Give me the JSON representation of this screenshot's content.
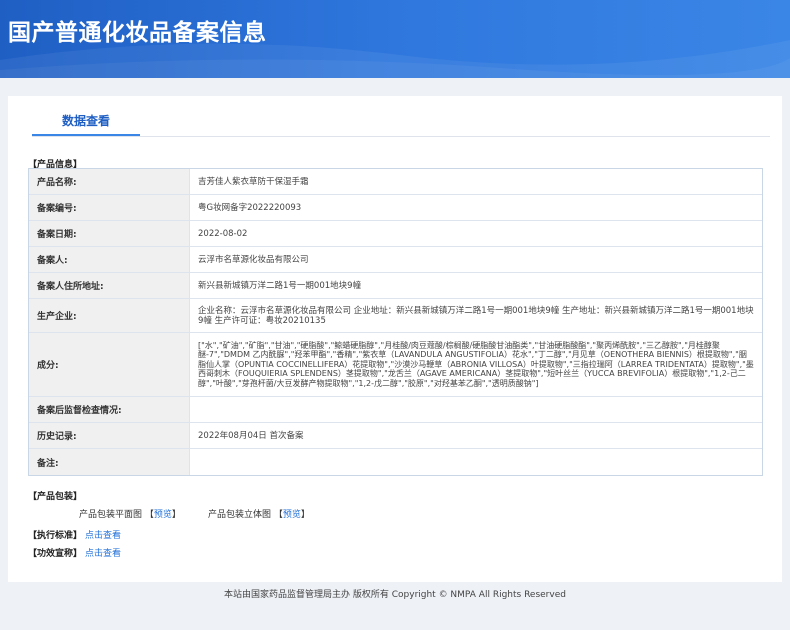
{
  "header": {
    "title": "国产普通化妆品备案信息"
  },
  "tab": {
    "label": "数据查看"
  },
  "sections": {
    "product_info": "【产品信息】",
    "product_package": "【产品包装】",
    "standard": "【执行标准】",
    "efficacy": "【功效宣称】"
  },
  "info_rows": [
    {
      "label": "产品名称:",
      "value": "吉芳佳人紫衣草防干保湿手霜"
    },
    {
      "label": "备案编号:",
      "value": "粤G妆网备字2022220093"
    },
    {
      "label": "备案日期:",
      "value": "2022-08-02"
    },
    {
      "label": "备案人:",
      "value": "云浮市名草源化妆品有限公司"
    },
    {
      "label": "备案人住所地址:",
      "value": "新兴县新城镇万洋二路1号一期001地块9幢"
    },
    {
      "label": "生产企业:",
      "value": "企业名称：云浮市名草源化妆品有限公司 企业地址：新兴县新城镇万洋二路1号一期001地块9幢 生产地址：新兴县新城镇万洋二路1号一期001地块9幢 生产许可证：粤妆20210135"
    },
    {
      "label": "成分:",
      "value": "[\"水\",\"矿油\",\"矿脂\",\"甘油\",\"硬脂酸\",\"鲸蜡硬脂醇\",\"月桂酸/肉豆蔻酸/棕榈酸/硬脂酸甘油酯类\",\"甘油硬脂酸酯\",\"聚丙烯酰胺\",\"三乙醇胺\",\"月桂醇聚醚-7\",\"DMDM 乙内酰脲\",\"羟苯甲酯\",\"香精\",\"紫衣草（LAVANDULA ANGUSTIFOLIA）花水\",\"丁二醇\",\"月见草（OENOTHERA BIENNIS）根提取物\",\"胭脂仙人掌（OPUNTIA COCCINELLIFERA）花提取物\",\"沙漠沙马鞭草（ABRONIA VILLOSA）叶提取物\",\"三指拉瑞阿（LARREA TRIDENTATA）提取物\",\"墨西哥刺木（FOUQUIERIA SPLENDENS）茎提取物\",\"龙舌兰（AGAVE AMERICANA）茎提取物\",\"短叶丝兰（YUCCA BREVIFOLIA）根提取物\",\"1,2-己二醇\",\"叶酸\",\"芽孢杆菌/大豆发酵产物提取物\",\"1,2-戊二醇\",\"胶原\",\"对羟基苯乙酮\",\"透明质酸钠\"]"
    },
    {
      "label": "备案后监督检查情况:",
      "value": ""
    },
    {
      "label": "历史记录:",
      "value": "2022年08月04日 首次备案"
    },
    {
      "label": "备注:",
      "value": ""
    }
  ],
  "package": {
    "flat_label": "产品包装平面图",
    "solid_label": "产品包装立体图",
    "preview_open": "【",
    "preview_text": "预览",
    "preview_close": "】"
  },
  "links": {
    "view": "点击查看"
  },
  "footer": {
    "text": "本站由国家药品监督管理局主办 版权所有 Copyright © NMPA All Rights Reserved"
  }
}
